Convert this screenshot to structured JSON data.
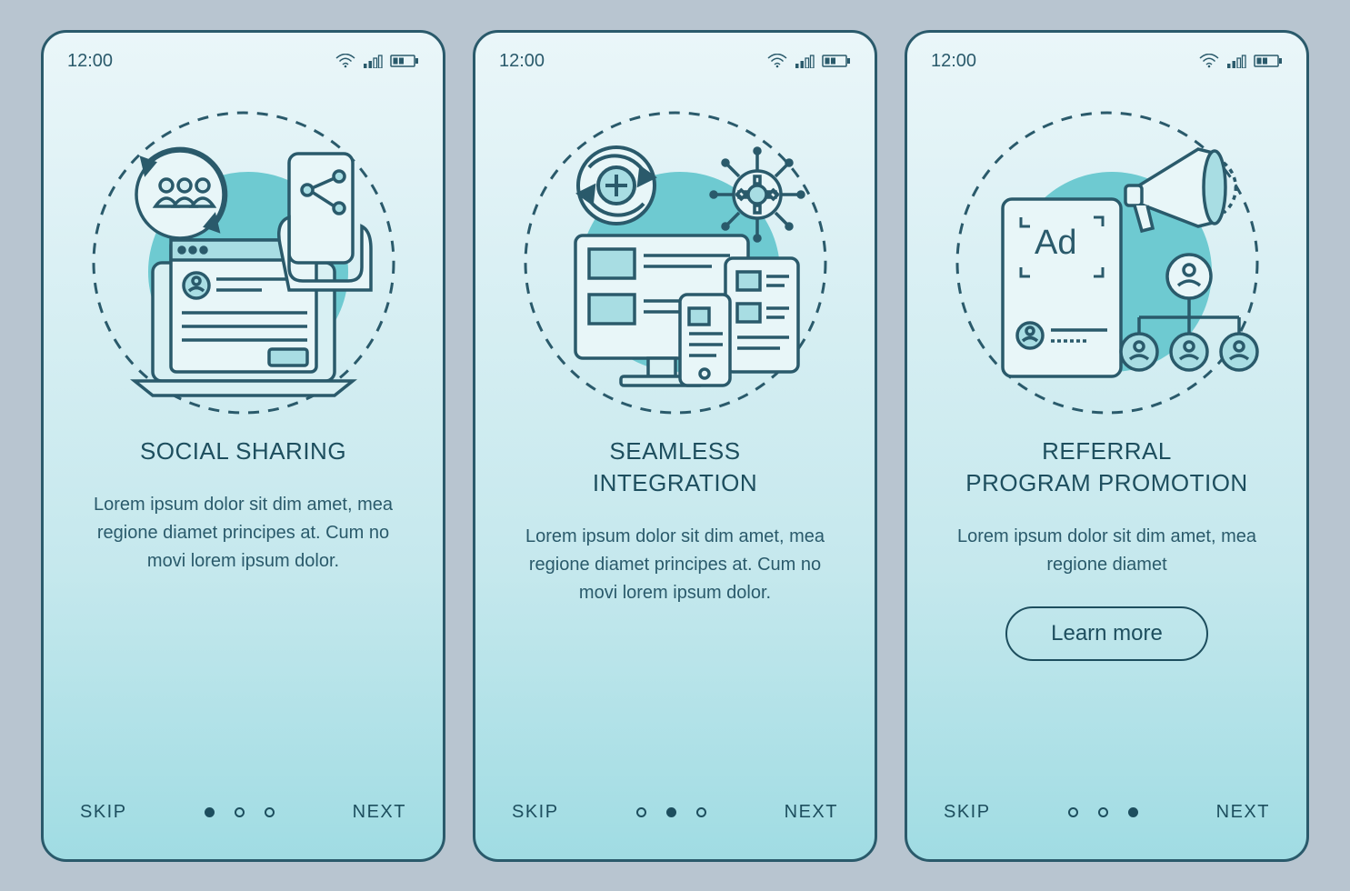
{
  "status": {
    "time": "12:00"
  },
  "screens": [
    {
      "title": "Social sharing",
      "body": "Lorem ipsum dolor sit dim amet, mea regione diamet principes at. Cum no movi lorem ipsum dolor.",
      "skip": "SKIP",
      "next": "NEXT",
      "activeDot": 0,
      "hasButton": false
    },
    {
      "title": "Seamless integration",
      "body": "Lorem ipsum dolor sit dim amet, mea regione diamet principes at. Cum no movi lorem ipsum dolor.",
      "skip": "SKIP",
      "next": "NEXT",
      "activeDot": 1,
      "hasButton": false
    },
    {
      "title": "Referral program promotion",
      "body": "Lorem ipsum dolor sit dim amet, mea regione diamet",
      "skip": "SKIP",
      "next": "NEXT",
      "activeDot": 2,
      "hasButton": true,
      "button": "Learn more"
    }
  ],
  "colors": {
    "border": "#2a5a6b",
    "accent": "#63c9d1"
  }
}
